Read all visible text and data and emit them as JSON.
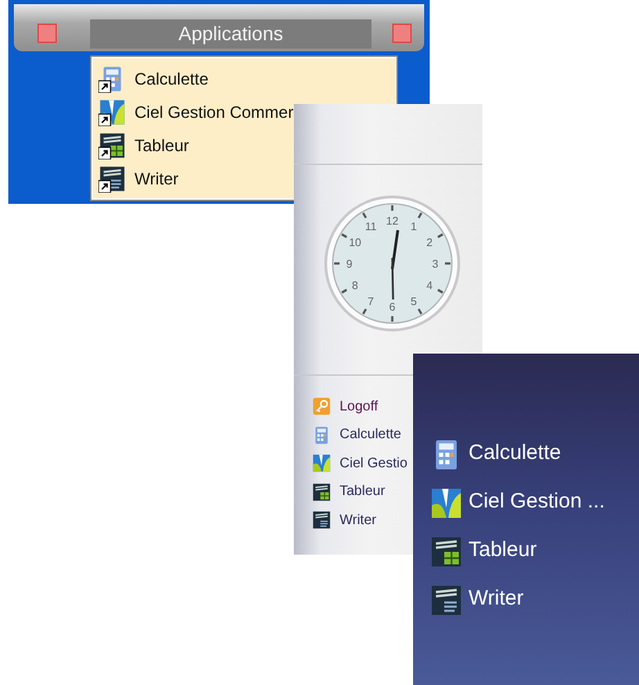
{
  "windows": [
    {
      "kind": "title-menu",
      "title": "Applications",
      "items": [
        {
          "kind": "calculator",
          "label": "Calculette"
        },
        {
          "kind": "logo",
          "label": "Ciel Gestion Commer"
        },
        {
          "kind": "spreadsheet",
          "label": "Tableur"
        },
        {
          "kind": "document",
          "label": "Writer"
        }
      ]
    },
    {
      "kind": "clock-menu",
      "clock": {
        "numerals": [
          "12",
          "1",
          "2",
          "3",
          "4",
          "5",
          "6",
          "7",
          "8",
          "9",
          "10",
          "11"
        ]
      },
      "items": [
        {
          "kind": "key",
          "label": "Logoff"
        },
        {
          "kind": "calculator",
          "label": "Calculette"
        },
        {
          "kind": "logo",
          "label": "Ciel Gestio"
        },
        {
          "kind": "spreadsheet",
          "label": "Tableur"
        },
        {
          "kind": "document",
          "label": "Writer"
        }
      ]
    },
    {
      "kind": "dark-menu",
      "items": [
        {
          "kind": "calculator",
          "label": "Calculette"
        },
        {
          "kind": "logo",
          "label": "Ciel Gestion ..."
        },
        {
          "kind": "spreadsheet",
          "label": "Tableur"
        },
        {
          "kind": "document",
          "label": "Writer"
        }
      ]
    }
  ]
}
